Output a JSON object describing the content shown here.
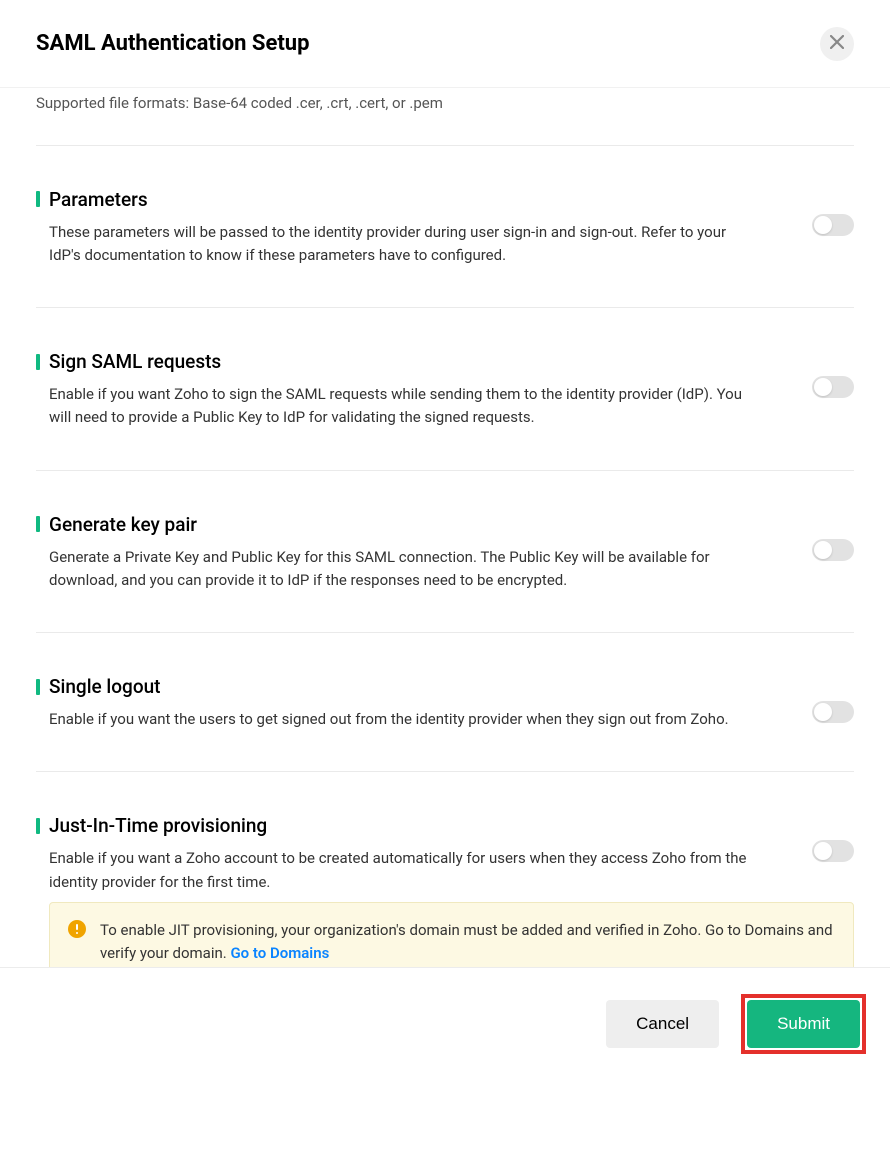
{
  "header": {
    "title": "SAML Authentication Setup"
  },
  "truncated": "Supported file formats: Base-64 coded .cer, .crt, .cert, or .pem",
  "sections": {
    "parameters": {
      "title": "Parameters",
      "desc": "These parameters will be passed to the identity provider during user sign-in and sign-out. Refer to your IdP's documentation to know if these parameters have to configured."
    },
    "sign_requests": {
      "title": "Sign SAML requests",
      "desc": "Enable if you want Zoho to sign the SAML requests while sending them to the identity provider (IdP). You will need to provide a Public Key to IdP for validating the signed requests."
    },
    "generate_key": {
      "title": "Generate key pair",
      "desc": "Generate a Private Key and Public Key for this SAML connection. The Public Key will be available for download, and you can provide it to IdP if the responses need to be encrypted."
    },
    "single_logout": {
      "title": "Single logout",
      "desc": "Enable if you want the users to get signed out from the identity provider when they sign out from Zoho."
    },
    "jit": {
      "title": "Just-In-Time provisioning",
      "desc": "Enable if you want a Zoho account to be created automatically for users when they access Zoho from the identity provider for the first time."
    }
  },
  "notice": {
    "text": "To enable JIT provisioning, your organization's domain must be added and verified in Zoho. Go to Domains and verify your domain. ",
    "link_label": "Go to Domains"
  },
  "footer": {
    "cancel": "Cancel",
    "submit": "Submit"
  }
}
